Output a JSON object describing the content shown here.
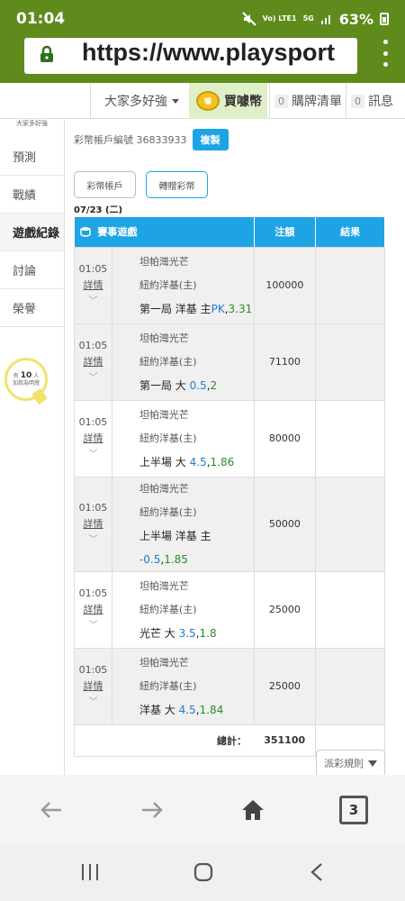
{
  "status": {
    "time": "01:04",
    "signal": "Vo) LTE1",
    "network": "5G",
    "battery": "63%"
  },
  "browser": {
    "url": "https://www.playsport",
    "tab_count": "3"
  },
  "nav": {
    "dropdown_label": "大家多好強",
    "buy_label": "買噱幣",
    "coin_text": "噱",
    "cart_count": "0",
    "cart_label": "購牌清單",
    "msg_count": "0",
    "msg_label": "訊息"
  },
  "sidebar": {
    "top_text": "大家多好強",
    "items": [
      {
        "label": "預測"
      },
      {
        "label": "戰績"
      },
      {
        "label": "遊戲紀錄"
      },
      {
        "label": "討論"
      },
      {
        "label": "榮譽"
      }
    ],
    "bulb_prefix": "有",
    "bulb_count": "10",
    "bulb_suffix": "人",
    "bulb_sub": "加我為明燈"
  },
  "account": {
    "label": "彩幣帳戶編號 36833933",
    "copy_label": "複製",
    "tab_wallet": "彩幣帳戶",
    "tab_transfer": "轉贈彩幣",
    "date": "07/23 (二)"
  },
  "table": {
    "headers": {
      "game": "賽事遊戲",
      "amount": "注額",
      "result": "結果"
    },
    "rows": [
      {
        "time": "01:05",
        "detail": "詳情",
        "away": "坦帕灣光芒",
        "home": "紐約洋基(主)",
        "bet_text": "第一局 洋基 主",
        "handicap": "PK",
        "odds": "3.31",
        "amount": "100000",
        "result": ""
      },
      {
        "time": "01:05",
        "detail": "詳情",
        "away": "坦帕灣光芒",
        "home": "紐約洋基(主)",
        "bet_text": "第一局 大",
        "handicap": "0.5",
        "odds": "2",
        "amount": "71100",
        "result": ""
      },
      {
        "time": "01:05",
        "detail": "詳情",
        "away": "坦帕灣光芒",
        "home": "紐約洋基(主)",
        "bet_text": "上半場 大",
        "handicap": "4.5",
        "odds": "1.86",
        "amount": "80000",
        "result": ""
      },
      {
        "time": "01:05",
        "detail": "詳情",
        "away": "坦帕灣光芒",
        "home": "紐約洋基(主)",
        "bet_text": "上半場 洋基 主",
        "handicap": "-0.5",
        "odds": "1.85",
        "amount": "50000",
        "result": ""
      },
      {
        "time": "01:05",
        "detail": "詳情",
        "away": "坦帕灣光芒",
        "home": "紐約洋基(主)",
        "bet_text": "光芒 大",
        "handicap": "3.5",
        "odds": "1.8",
        "amount": "25000",
        "result": ""
      },
      {
        "time": "01:05",
        "detail": "詳情",
        "away": "坦帕灣光芒",
        "home": "紐約洋基(主)",
        "bet_text": "洋基 大",
        "handicap": "4.5",
        "odds": "1.84",
        "amount": "25000",
        "result": ""
      }
    ],
    "total_label": "總計：",
    "total_amount": "351100"
  },
  "rule_button": "派彩規則"
}
